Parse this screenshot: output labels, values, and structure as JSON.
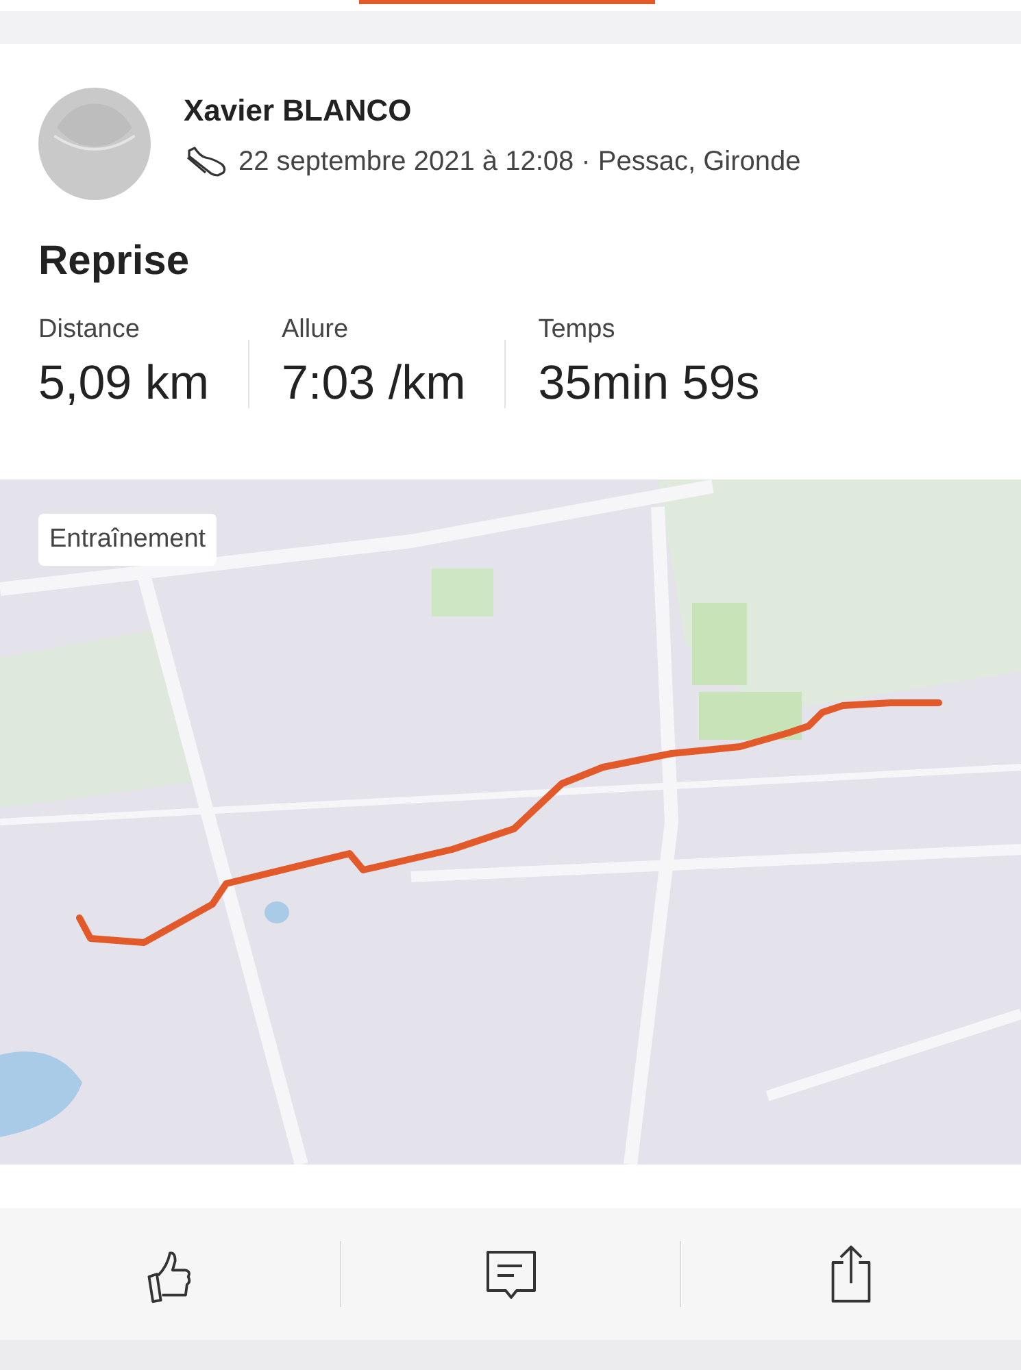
{
  "athlete": {
    "name": "Xavier BLANCO",
    "meta": "22 septembre 2021 à 12:08 · Pessac, Gironde"
  },
  "title": "Reprise",
  "stats": [
    {
      "label": "Distance",
      "value": "5,09 km"
    },
    {
      "label": "Allure",
      "value": "7:03 /km"
    },
    {
      "label": "Temps",
      "value": "35min 59s"
    }
  ],
  "map": {
    "kind": "picture",
    "tag": "Entraînement"
  },
  "actions": [
    {
      "kind": "like"
    },
    {
      "kind": "comment"
    },
    {
      "kind": "share"
    }
  ]
}
